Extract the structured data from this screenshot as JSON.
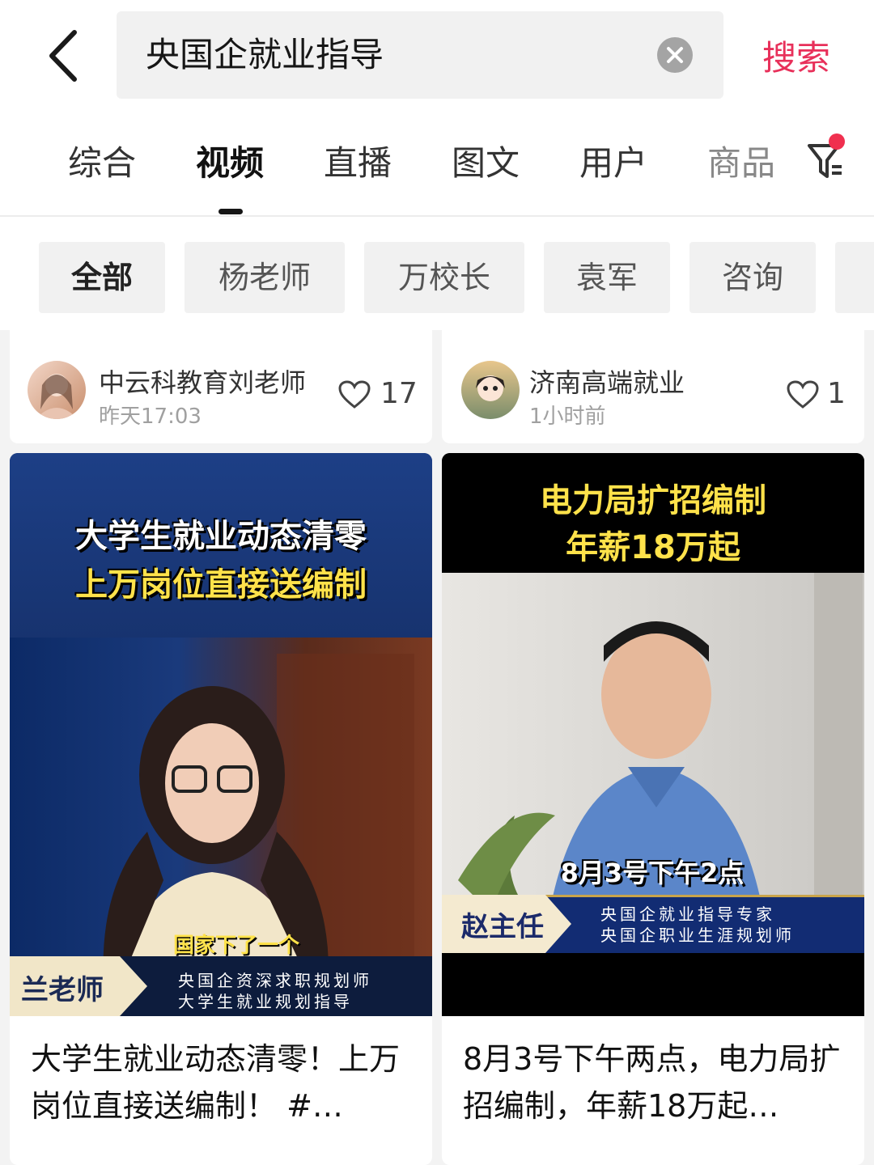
{
  "search": {
    "query": "央国企就业指导",
    "button_label": "搜索"
  },
  "tabs": [
    "综合",
    "视频",
    "直播",
    "图文",
    "用户",
    "商品"
  ],
  "chips": [
    "全部",
    "杨老师",
    "万校长",
    "袁军",
    "咨询"
  ],
  "top_cards": [
    {
      "author": "中云科教育刘老师",
      "time": "昨天17:03",
      "likes": "17"
    },
    {
      "author": "济南高端就业",
      "time": "1小时前",
      "likes": "1"
    }
  ],
  "videos": [
    {
      "overlay_line1": "大学生就业动态清零",
      "overlay_line2": "上万岗位直接送编制",
      "caption": "国家下了一个",
      "presenter": "兰老师",
      "presenter_title1": "央国企资深求职规划师",
      "presenter_title2": "大学生就业规划指导",
      "title": "大学生就业动态清零！上万岗位直接送编制！ #…"
    },
    {
      "overlay_line1": "电力局扩招编制",
      "overlay_line2": "年薪18万起",
      "caption": "8月3号下午2点",
      "presenter": "赵主任",
      "presenter_title1": "央国企就业指导专家",
      "presenter_title2": "央国企职业生涯规划师",
      "title": "8月3号下午两点，电力局扩招编制，年薪18万起…"
    }
  ],
  "colors": {
    "accent": "#e8305a",
    "overlay_yellow": "#ffe24a",
    "deep_blue": "#1e3a8a"
  }
}
